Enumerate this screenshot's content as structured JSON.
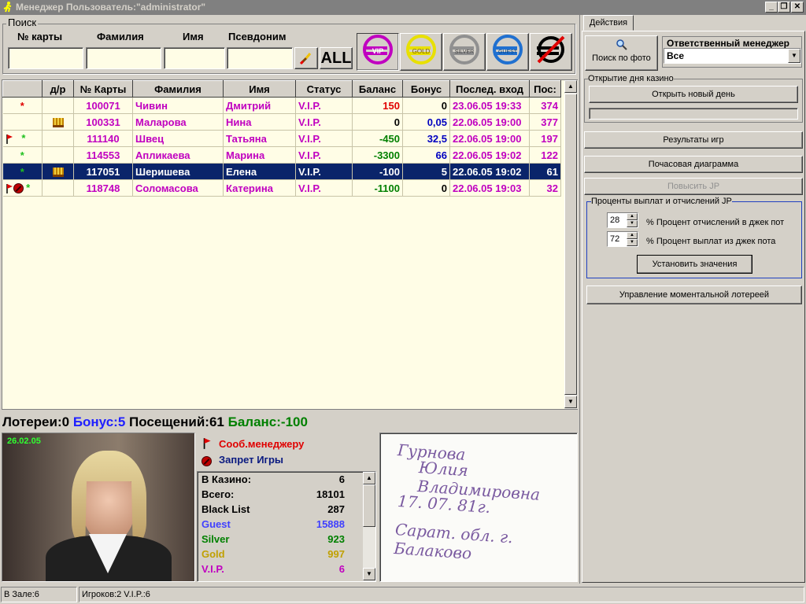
{
  "window": {
    "title": "Менеджер Пользователь:\"administrator\"",
    "controls": [
      "_",
      "❐",
      "✕"
    ]
  },
  "search": {
    "group_label": "Поиск",
    "labels": [
      "№ карты",
      "Фамилия",
      "Имя",
      "Псевдоним"
    ],
    "values": [
      "",
      "",
      "",
      ""
    ],
    "all_button": "ALL",
    "card_buttons": [
      "VIP",
      "GOLD",
      "SILVER",
      "GUEST",
      ""
    ]
  },
  "grid": {
    "columns": [
      "",
      "д/р",
      "№ Карты",
      "Фамилия",
      "Имя",
      "Статус",
      "Баланс",
      "Бонус",
      "Послед. вход",
      "Пос:"
    ],
    "rows": [
      {
        "card": "100071",
        "surname": "Чивин",
        "name": "Дмитрий",
        "status": "V.I.P.",
        "balance": "150",
        "bonus": "0",
        "last": "23.06.05 19:33",
        "visits": "374"
      },
      {
        "card": "100331",
        "surname": "Маларова",
        "name": "Нина",
        "status": "V.I.P.",
        "balance": "0",
        "bonus": "0,05",
        "last": "22.06.05 19:00",
        "visits": "377"
      },
      {
        "card": "111140",
        "surname": "Швец",
        "name": "Татьяна",
        "status": "V.I.P.",
        "balance": "-450",
        "bonus": "32,5",
        "last": "22.06.05 19:00",
        "visits": "197"
      },
      {
        "card": "114553",
        "surname": "Апликаева",
        "name": "Марина",
        "status": "V.I.P.",
        "balance": "-3300",
        "bonus": "66",
        "last": "22.06.05 19:02",
        "visits": "122"
      },
      {
        "card": "117051",
        "surname": "Шеришева",
        "name": "Елена",
        "status": "V.I.P.",
        "balance": "-100",
        "bonus": "5",
        "last": "22.06.05 19:02",
        "visits": "61"
      },
      {
        "card": "118748",
        "surname": "Соломасова",
        "name": "Катерина",
        "status": "V.I.P.",
        "balance": "-1100",
        "bonus": "0",
        "last": "22.06.05 19:03",
        "visits": "32"
      }
    ]
  },
  "info": {
    "lotteries": "Лотереи:0",
    "bonus": "Бонус:5",
    "visits": "Посещений:61",
    "balance": "Баланс:-100"
  },
  "photo": {
    "date": "26.02.05"
  },
  "legend": {
    "msg": "Сооб.менеджеру",
    "ban": "Запрет Игры"
  },
  "stats": [
    {
      "label": "В Казино:",
      "value": "6",
      "color": "#000000"
    },
    {
      "label": "Всего:",
      "value": "18101",
      "color": "#000000"
    },
    {
      "label": "Black List",
      "value": "287",
      "color": "#000000"
    },
    {
      "label": "Guest",
      "value": "15888",
      "color": "#4040ff"
    },
    {
      "label": "Silver",
      "value": "923",
      "color": "#008000"
    },
    {
      "label": "Gold",
      "value": "997",
      "color": "#c0a000"
    },
    {
      "label": "V.I.P.",
      "value": "6",
      "color": "#c000c0"
    }
  ],
  "signature_lines": [
    "Гурнова",
    "Юлия Владимировна",
    "17. 07. 81г.",
    "Сарат. обл. г. Балаково"
  ],
  "right": {
    "tab": "Действия",
    "photo_search": "Поиск по фото",
    "manager_label": "Ответственный менеджер",
    "manager_value": "Все",
    "day_group": "Открытие дня казино",
    "open_day": "Открыть новый день",
    "results": "Результаты игр",
    "hourly": "Почасовая диаграмма",
    "raise_jp": "Повысить JP",
    "jp_group": "Проценты выплат и отчислений JP",
    "jp_pct1": "28",
    "jp_label1": "% Процент отчислений в джек пот",
    "jp_pct2": "72",
    "jp_label2": "% Процент выплат из  джек  пота",
    "set_values": "Установить значения",
    "lottery": "Управление моментальной лотереей"
  },
  "statusbar": {
    "hall": "В Зале:6",
    "players": "Игроков:2 V.I.P.:6"
  }
}
